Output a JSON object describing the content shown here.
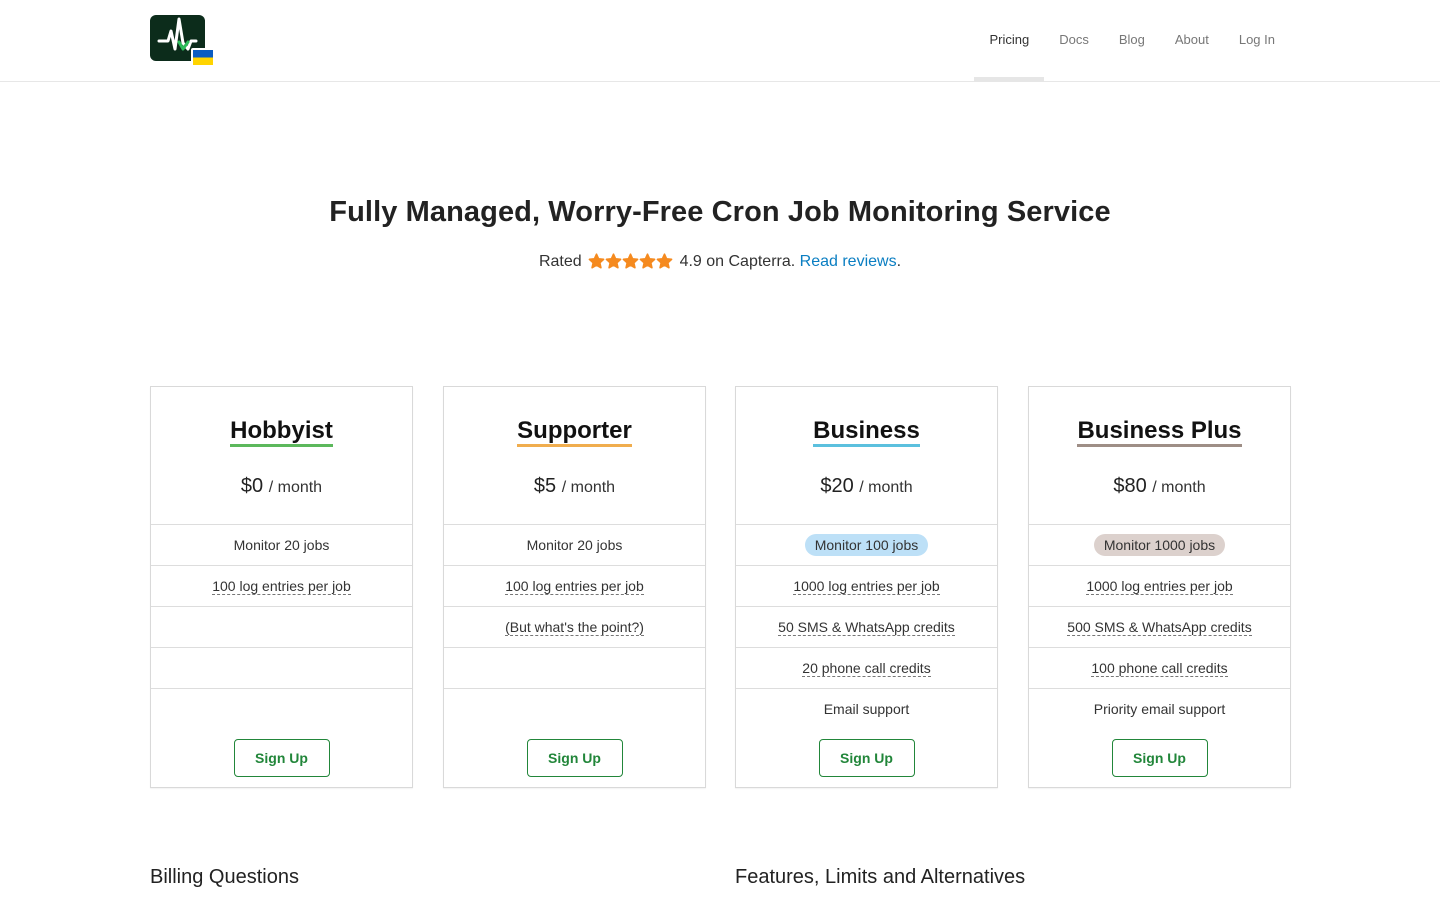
{
  "nav": {
    "items": [
      {
        "label": "Pricing",
        "active": true
      },
      {
        "label": "Docs",
        "active": false
      },
      {
        "label": "Blog",
        "active": false
      },
      {
        "label": "About",
        "active": false
      },
      {
        "label": "Log In",
        "active": false
      }
    ]
  },
  "logo": {
    "icon": "pulse-logo-icon",
    "flag": "ukraine-flag-icon"
  },
  "hero": {
    "title": "Fully Managed, Worry-Free Cron Job Monitoring Service",
    "rating_prefix": "Rated",
    "rating_score_text": "4.9 on Capterra.",
    "rating_link": "Read reviews",
    "rating_suffix": ".",
    "stars": 5,
    "star_color": "#f58a1f"
  },
  "plans": [
    {
      "name": "Hobbyist",
      "underline_color": "#5cb85c",
      "price": "$0",
      "period": "/ month",
      "rows": [
        {
          "text": "Monitor 20 jobs",
          "style": "plain"
        },
        {
          "text": "100 log entries per job",
          "style": "dash"
        },
        {
          "text": "",
          "style": "plain"
        },
        {
          "text": "",
          "style": "plain"
        }
      ],
      "support": "",
      "button": "Sign Up"
    },
    {
      "name": "Supporter",
      "underline_color": "#f0ad4e",
      "price": "$5",
      "period": "/ month",
      "rows": [
        {
          "text": "Monitor 20 jobs",
          "style": "plain"
        },
        {
          "text": "100 log entries per job",
          "style": "dash"
        },
        {
          "text": "(But what's the point?)",
          "style": "dash"
        },
        {
          "text": "",
          "style": "plain"
        }
      ],
      "support": "",
      "button": "Sign Up"
    },
    {
      "name": "Business",
      "underline_color": "#5bc0de",
      "price": "$20",
      "period": "/ month",
      "rows": [
        {
          "text": "Monitor 100 jobs",
          "style": "pill",
          "pill_color": "#bde0f7"
        },
        {
          "text": "1000 log entries per job",
          "style": "dash"
        },
        {
          "text": "50 SMS & WhatsApp credits",
          "style": "dash"
        },
        {
          "text": "20 phone call credits",
          "style": "dash"
        }
      ],
      "support": "Email support",
      "button": "Sign Up"
    },
    {
      "name": "Business Plus",
      "underline_color": "#9e8e86",
      "price": "$80",
      "period": "/ month",
      "rows": [
        {
          "text": "Monitor 1000 jobs",
          "style": "pill",
          "pill_color": "#dcd1cd"
        },
        {
          "text": "1000 log entries per job",
          "style": "dash"
        },
        {
          "text": "500 SMS & WhatsApp credits",
          "style": "dash"
        },
        {
          "text": "100 phone call credits",
          "style": "dash"
        }
      ],
      "support": "Priority email support",
      "button": "Sign Up"
    }
  ],
  "sections": {
    "billing": "Billing Questions",
    "features": "Features, Limits and Alternatives"
  }
}
